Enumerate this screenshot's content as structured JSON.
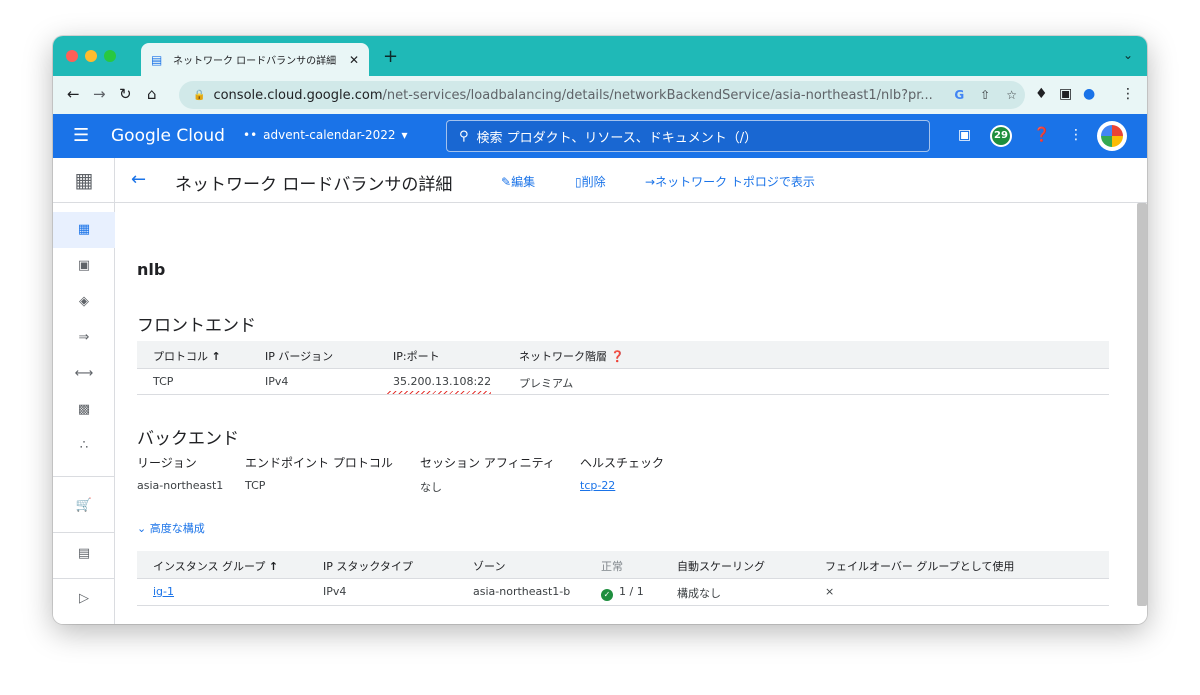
{
  "browser": {
    "tab_title": "ネットワーク ロードバランサの詳細",
    "new_tab": "+",
    "url_host": "console.cloud.google.com",
    "url_path": "/net-services/loadbalancing/details/networkBackendService/asia-northeast1/nlb?pr..."
  },
  "header": {
    "logo": "Google Cloud",
    "project": "advent-calendar-2022",
    "search_placeholder": "検索  プロダクト、リソース、ドキュメント（/）",
    "notifications": "29"
  },
  "page": {
    "title": "ネットワーク ロードバランサの詳細",
    "edit": "編集",
    "delete": "削除",
    "topology": "ネットワーク トポロジで表示",
    "lb_name": "nlb"
  },
  "frontend": {
    "title": "フロントエンド",
    "headers": [
      "プロトコル",
      "IP バージョン",
      "IP:ポート",
      "ネットワーク階層"
    ],
    "row": [
      "TCP",
      "IPv4",
      "35.200.13.108:22",
      "プレミアム"
    ]
  },
  "backend": {
    "title": "バックエンド",
    "headers": [
      "リージョン",
      "エンドポイント プロトコル",
      "セッション アフィニティ",
      "ヘルスチェック"
    ],
    "values": [
      "asia-northeast1",
      "TCP",
      "なし",
      "tcp-22"
    ],
    "advanced": "高度な構成",
    "group_headers": [
      "インスタンス グループ",
      "IP スタックタイプ",
      "ゾーン",
      "正常",
      "自動スケーリング",
      "フェイルオーバー グループとして使用"
    ],
    "group_row": [
      "ig-1",
      "IPv4",
      "asia-northeast1-b",
      "1 / 1",
      "構成なし",
      "×"
    ]
  },
  "colors": {
    "tabstrip": "#1fb9b7",
    "header": "#1a73e8",
    "accent": "#1a73e8",
    "ok": "#1e8e3e"
  }
}
